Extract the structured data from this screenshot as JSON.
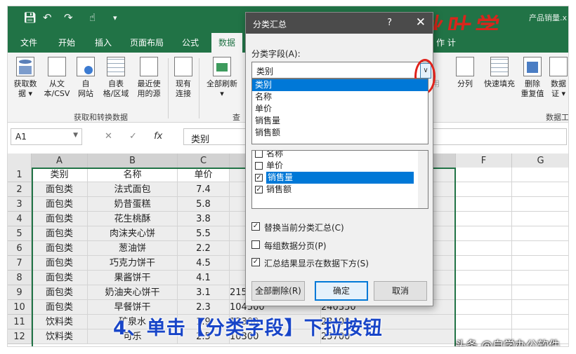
{
  "titlebar": {
    "doc_title": "产品销量.x",
    "quick_access": {
      "save_icon": "save-icon",
      "undo_icon": "undo-icon",
      "redo_icon": "redo-icon",
      "touch_icon": "touch-mode-icon",
      "customize_icon": "customize-icon"
    },
    "brush_text": "秋叶学",
    "color": "#217346"
  },
  "ribbon_tabs": [
    "文件",
    "开始",
    "插入",
    "页面布局",
    "公式",
    "数据"
  ],
  "ribbon_tab_extra": "作    计",
  "ribbon": {
    "buttons": [
      {
        "label1": "获取数",
        "label2": "据 ▾",
        "icon": "database-icon"
      },
      {
        "label1": "从文",
        "label2": "本/CSV",
        "icon": "text-file-icon"
      },
      {
        "label1": "自",
        "label2": "网站",
        "icon": "web-icon"
      },
      {
        "label1": "自表",
        "label2": "格/区域",
        "icon": "table-icon"
      },
      {
        "label1": "最近使",
        "label2": "用的源",
        "icon": "recent-source-icon"
      },
      {
        "label1": "现有",
        "label2": "连接",
        "icon": "connection-icon"
      },
      {
        "label1": "全部刷新",
        "label2": "▾",
        "icon": "refresh-all-icon"
      }
    ],
    "right_buttons": [
      {
        "label1": "分列",
        "label2": "",
        "icon": "split-column-icon"
      },
      {
        "label1": "快速填充",
        "label2": "",
        "icon": "flash-fill-icon"
      },
      {
        "label1": "删除",
        "label2": "重复值",
        "icon": "remove-duplicates-icon"
      },
      {
        "label1": "数据",
        "label2": "证 ▾",
        "icon": "data-validation-icon"
      }
    ],
    "group_get": "获取和转换数据",
    "group_query": "查",
    "group_tools": "数据工",
    "faded_use": "用"
  },
  "formula_bar": {
    "name_box": "A1",
    "content": "类别",
    "cancel": "✕",
    "enter": "✓",
    "fx": "fx"
  },
  "columns": [
    "A",
    "B",
    "C",
    "F",
    "G"
  ],
  "rows": [
    "1",
    "2",
    "3",
    "4",
    "5",
    "6",
    "7",
    "8",
    "9",
    "10",
    "11",
    "12"
  ],
  "table": {
    "headers": [
      "类别",
      "名称",
      "单价"
    ],
    "data": [
      [
        "面包类",
        "法式面包",
        "7.4"
      ],
      [
        "面包类",
        "奶昔蛋糕",
        "5.8"
      ],
      [
        "面包类",
        "花生桃酥",
        "3.8"
      ],
      [
        "面包类",
        "肉沫夹心饼",
        "5.5"
      ],
      [
        "面包类",
        "葱油饼",
        "2.2"
      ],
      [
        "面包类",
        "巧克力饼干",
        "4.5"
      ],
      [
        "面包类",
        "果酱饼干",
        "4.1"
      ],
      [
        "面包类",
        "奶油夹心饼干",
        "3.1"
      ],
      [
        "面包类",
        "早餐饼干",
        "2.3"
      ],
      [
        "饮料类",
        "矿泉水",
        "1.9"
      ],
      [
        "饮料类",
        "可乐",
        "2.5"
      ]
    ],
    "extra_col_d": [
      "215300",
      "104500",
      "12300",
      "10300"
    ],
    "extra_col_e": [
      "607400",
      "240350",
      "23400",
      "25700"
    ]
  },
  "dialog": {
    "title": "分类汇总",
    "help": "?",
    "close": "✕",
    "field_label": "分类字段(A):",
    "combo_value": "类别",
    "dropdown_items": [
      "类别",
      "名称",
      "单价",
      "销售量",
      "销售额"
    ],
    "selected_index": 0,
    "checklist": [
      {
        "label": "名称",
        "checked": false
      },
      {
        "label": "单价",
        "checked": false
      },
      {
        "label": "销售量",
        "checked": true,
        "selected": true
      },
      {
        "label": "销售额",
        "checked": true
      }
    ],
    "options": [
      {
        "label": "替换当前分类汇总(C)",
        "checked": true
      },
      {
        "label": "每组数据分页(P)",
        "checked": false
      },
      {
        "label": "汇总结果显示在数据下方(S)",
        "checked": true
      }
    ],
    "btn_remove_all": "全部删除(R)",
    "btn_ok": "确定",
    "btn_cancel": "取消"
  },
  "caption": "4、单击【分类字段】下拉按钮",
  "watermark": "头条 @自学办公软件"
}
